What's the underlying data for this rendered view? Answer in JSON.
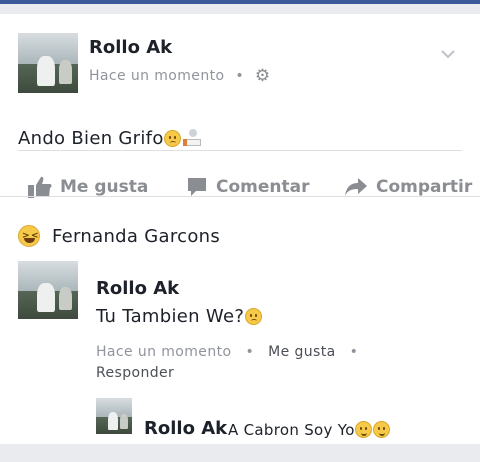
{
  "post": {
    "author": "Rollo Ak",
    "timestamp": "Hace un momento",
    "separator": "•",
    "text": "Ando Bien Grifo",
    "text_emojis": [
      "worried-face",
      "smoking-cigarette"
    ],
    "privacy_icon": "gear-icon",
    "menu_icon": "chevron-down-icon"
  },
  "actions": [
    {
      "label": "Me gusta",
      "icon": "thumbs-up-icon"
    },
    {
      "label": "Comentar",
      "icon": "comment-icon"
    },
    {
      "label": "Compartir",
      "icon": "share-arrow-icon"
    }
  ],
  "reaction": {
    "emoji": "laughing-face",
    "name": "Fernanda Garcons"
  },
  "comment": {
    "author": "Rollo Ak",
    "text": "Tu Tambien We?",
    "text_emoji": "worried-face",
    "timestamp": "Hace un momento",
    "separator": "•",
    "like_label": "Me gusta",
    "reply_label": "Responder"
  },
  "reply": {
    "author": "Rollo Ak",
    "text": "A Cabron Soy Yo",
    "text_emojis": [
      "tears-of-joy",
      "tears-of-joy"
    ]
  },
  "colors": {
    "brand_blue": "#3b5998",
    "action_gray": "#8a8d91",
    "text": "#1d2129",
    "meta_gray": "#90949c"
  }
}
